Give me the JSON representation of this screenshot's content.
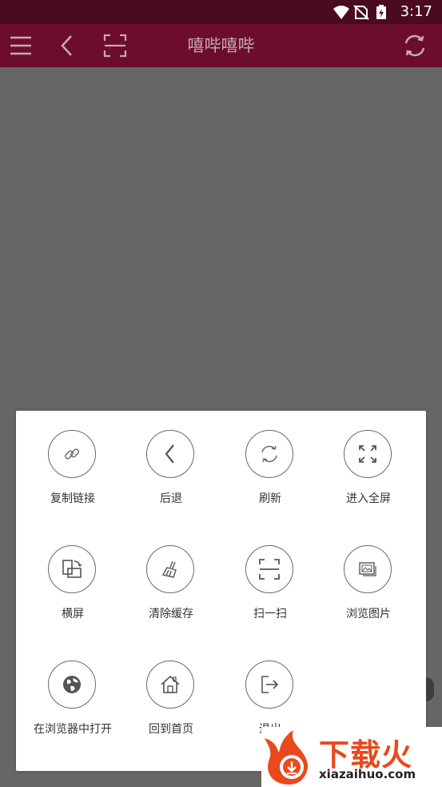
{
  "status_bar": {
    "time": "3:17",
    "icons": [
      "wifi-icon",
      "no-sim-icon",
      "battery-charging-icon"
    ]
  },
  "toolbar": {
    "title": "嘻哔嘻哔",
    "icons": [
      "menu-icon",
      "back-icon",
      "scan-icon",
      "refresh-icon"
    ],
    "background": "#6d0d2c"
  },
  "menu": {
    "items": [
      {
        "label": "复制链接",
        "icon": "link-icon"
      },
      {
        "label": "后退",
        "icon": "back-arrow-icon"
      },
      {
        "label": "刷新",
        "icon": "refresh-icon"
      },
      {
        "label": "进入全屏",
        "icon": "fullscreen-icon"
      },
      {
        "label": "横屏",
        "icon": "rotate-screen-icon"
      },
      {
        "label": "清除缓存",
        "icon": "broom-icon"
      },
      {
        "label": "扫一扫",
        "icon": "scan-icon"
      },
      {
        "label": "浏览图片",
        "icon": "image-icon"
      },
      {
        "label": "在浏览器中打开",
        "icon": "globe-icon"
      },
      {
        "label": "回到首页",
        "icon": "home-icon"
      },
      {
        "label": "退出",
        "icon": "exit-icon"
      }
    ]
  },
  "watermark": {
    "brand": "下载火",
    "url": "xiazaihuo.com",
    "color": "#e8491d"
  }
}
